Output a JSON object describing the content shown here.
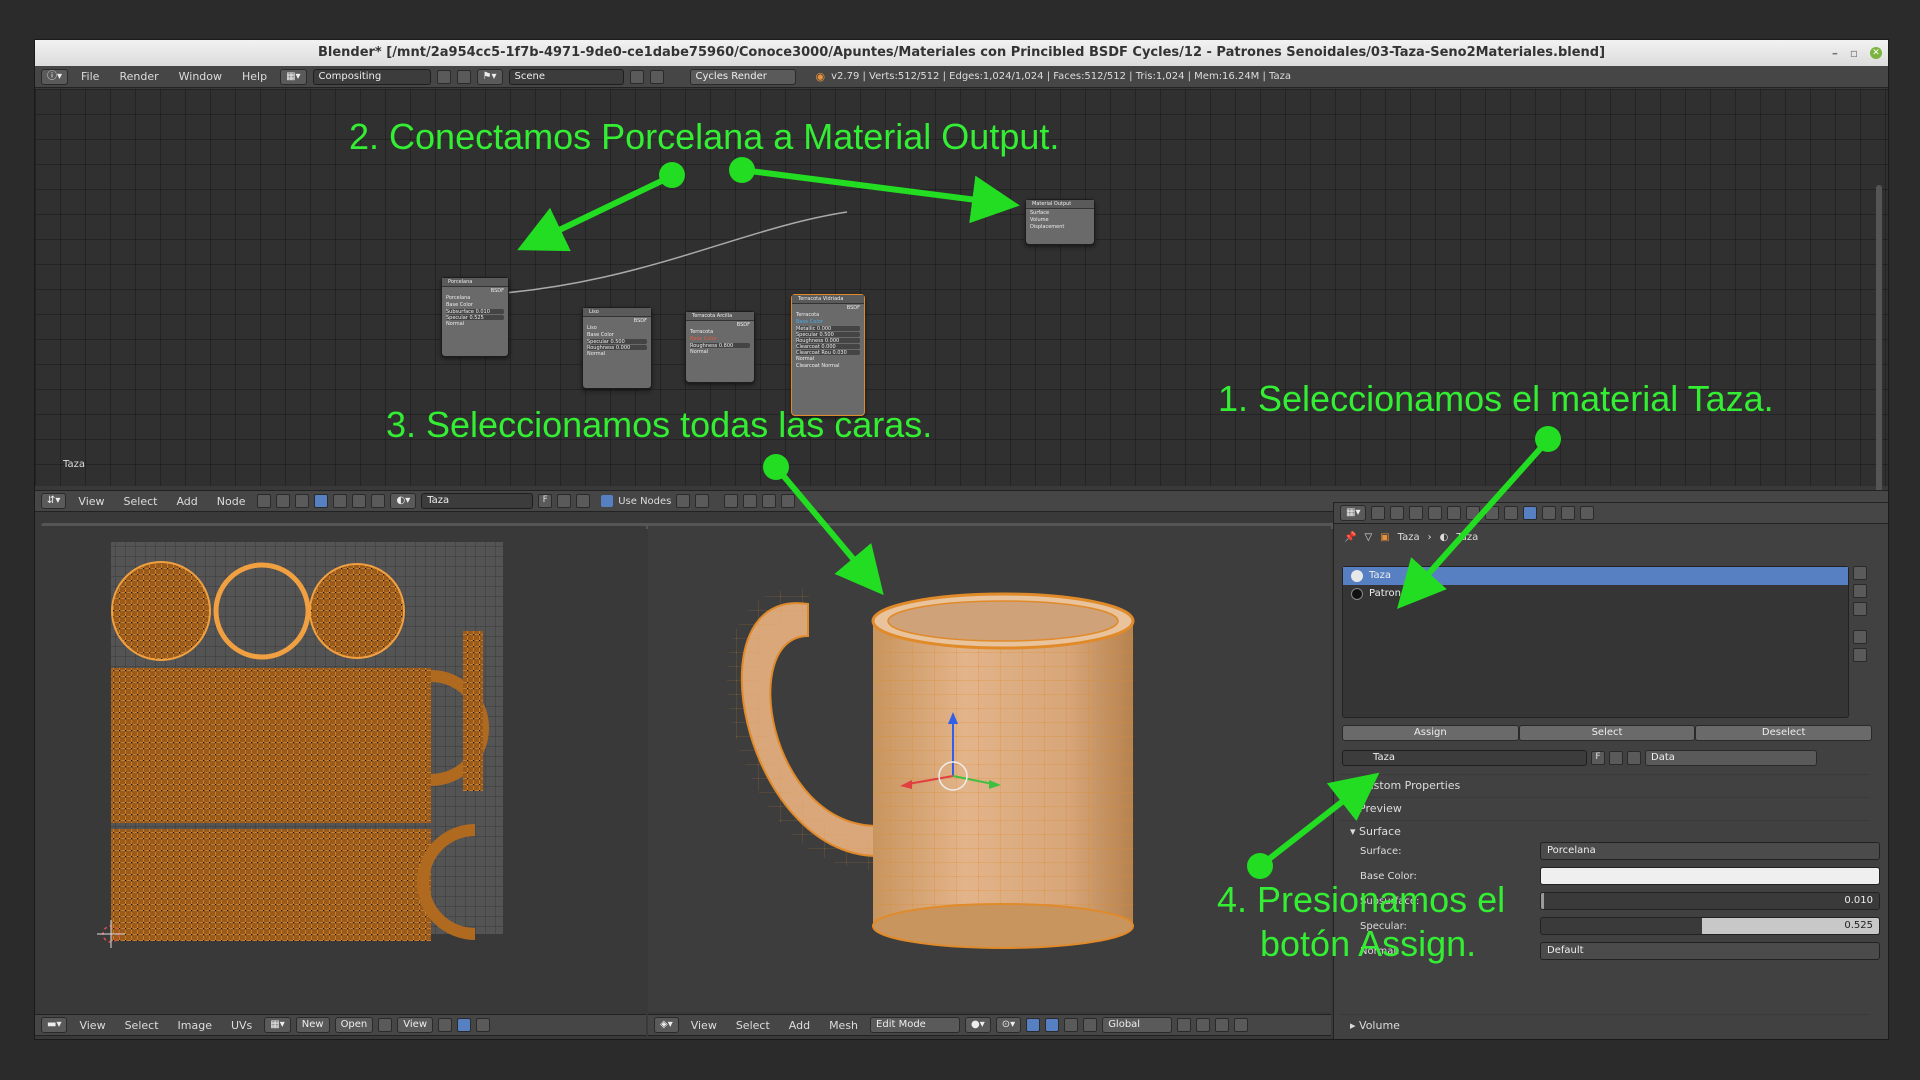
{
  "window": {
    "title": "Blender* [/mnt/2a954cc5-1f7b-4971-9de0-ce1dabe75960/Conoce3000/Apuntes/Materiales con Princibled BSDF Cycles/12 - Patrones Senoidales/03-Taza-Seno2Materiales.blend]"
  },
  "topbar": {
    "menus": [
      "File",
      "Render",
      "Window",
      "Help"
    ],
    "screen_layout": "Compositing",
    "scene": "Scene",
    "render_engine": "Cycles Render",
    "stats": "v2.79 | Verts:512/512 | Edges:1,024/1,024 | Faces:512/512 | Tris:1,024 | Mem:16.24M | Taza"
  },
  "node_editor": {
    "material_label": "Taza",
    "nodes": [
      {
        "title": "Porcelana",
        "type": "BSDF",
        "rows": [
          "Porcelana",
          "Base Color",
          "Subsurface 0.010",
          "Specular 0.525",
          "Normal"
        ]
      },
      {
        "title": "Liso",
        "type": "BSDF",
        "rows": [
          "Liso",
          "Base Color",
          "Specular 0.500",
          "Roughness 0.000",
          "Normal"
        ]
      },
      {
        "title": "Terracota Arcilla",
        "type": "BSDF",
        "rows": [
          "Terracota",
          "Base Color",
          "Roughness 0.800",
          "Normal"
        ]
      },
      {
        "title": "Terracota Vidriada",
        "type": "BSDF",
        "rows": [
          "Terracota",
          "Base Color",
          "Metallic 0.000",
          "Specular 0.500",
          "Roughness 0.000",
          "Clearcoat 0.000",
          "Clearcoat Rou 0.030",
          "Normal",
          "Clearcoat Normal"
        ]
      },
      {
        "title": "Material Output",
        "type": "",
        "rows": [
          "Surface",
          "Volume",
          "Displacement"
        ]
      }
    ],
    "header": {
      "menus": [
        "View",
        "Select",
        "Add",
        "Node"
      ],
      "material": "Taza",
      "fake_user": "F",
      "use_nodes_label": "Use Nodes"
    }
  },
  "uv_editor": {
    "menus": [
      "View",
      "Select",
      "Image",
      "UVs"
    ],
    "new_label": "New",
    "open_label": "Open",
    "view_label": "View"
  },
  "view3d": {
    "menus": [
      "View",
      "Select",
      "Add",
      "Mesh"
    ],
    "mode": "Edit Mode",
    "orientation": "Global"
  },
  "properties": {
    "breadcrumb": [
      "Taza",
      "Taza"
    ],
    "slots": [
      {
        "name": "Taza",
        "selected": true,
        "color": "#e8e8e8"
      },
      {
        "name": "Patrones",
        "selected": false,
        "color": "#111111"
      }
    ],
    "assign_label": "Assign",
    "select_label": "Select",
    "deselect_label": "Deselect",
    "material_field": "Taza",
    "fake_user": "F",
    "link": "Data",
    "sections": [
      "Custom Properties",
      "Preview",
      "Surface",
      "Volume"
    ],
    "surface": {
      "surface_label": "Surface:",
      "surface_value": "Porcelana",
      "base_color_label": "Base Color:",
      "subsurface_label": "Subsurface:",
      "subsurface_value": "0.010",
      "subsurface_fraction": 0.01,
      "specular_label": "Specular:",
      "specular_value": "0.525",
      "specular_fraction": 0.525,
      "normal_label": "Normal:",
      "normal_value": "Default"
    }
  },
  "annotations": {
    "step1": "1. Seleccionamos el material Taza.",
    "step2": "2. Conectamos Porcelana a Material Output.",
    "step3": "3. Seleccionamos todas las caras.",
    "step4_line1": "4. Presionamos el",
    "step4_line2": "botón Assign."
  },
  "colors": {
    "annotation": "#33ee33",
    "selection": "#5680c2",
    "mesh_orange": "#e08a2a",
    "mug_body": "#d7a679"
  }
}
